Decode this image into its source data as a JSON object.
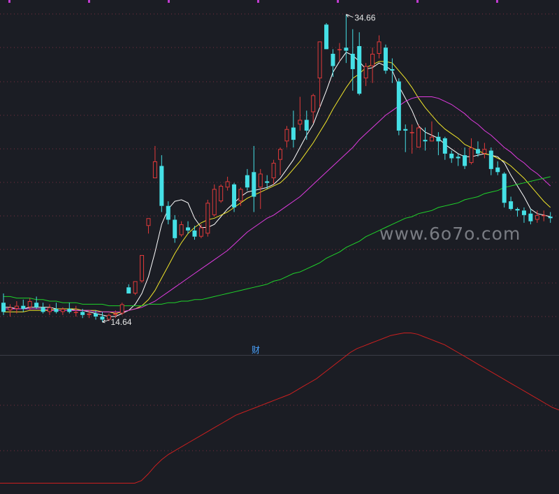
{
  "chart_data": [
    {
      "type": "candlestick",
      "annotations": {
        "high_label": "34.66",
        "low_label": "14.64"
      },
      "watermark": "www.6o7o.com",
      "ylim": [
        12.5,
        35.6
      ],
      "candles": [
        [
          15.9,
          16.5,
          15.1,
          15.3
        ],
        [
          15.4,
          15.8,
          15.0,
          15.6
        ],
        [
          15.5,
          16.0,
          15.2,
          15.7
        ],
        [
          15.7,
          16.1,
          15.3,
          15.5
        ],
        [
          15.6,
          16.2,
          15.4,
          16.0
        ],
        [
          15.9,
          16.3,
          15.5,
          15.6
        ],
        [
          15.6,
          15.9,
          15.2,
          15.3
        ],
        [
          15.3,
          15.8,
          15.1,
          15.6
        ],
        [
          15.5,
          15.9,
          15.2,
          15.3
        ],
        [
          15.3,
          15.6,
          15.1,
          15.5
        ],
        [
          15.5,
          15.9,
          15.2,
          15.3
        ],
        [
          15.3,
          15.7,
          15.0,
          15.3
        ],
        [
          15.3,
          15.5,
          14.9,
          15.1
        ],
        [
          15.1,
          15.4,
          14.9,
          15.2
        ],
        [
          15.2,
          15.4,
          14.8,
          15.0
        ],
        [
          15.0,
          15.3,
          14.64,
          14.8
        ],
        [
          14.8,
          15.2,
          14.7,
          15.1
        ],
        [
          15.1,
          15.4,
          14.9,
          15.2
        ],
        [
          15.2,
          15.9,
          15.1,
          15.8
        ],
        [
          16.9,
          17.1,
          16.5,
          16.5
        ],
        [
          16.5,
          17.3,
          16.4,
          17.3
        ],
        [
          17.3,
          19.0,
          17.2,
          19.0
        ],
        [
          20.9,
          21.4,
          20.4,
          21.4
        ],
        [
          24.0,
          26.1,
          24.0,
          25.1
        ],
        [
          24.8,
          25.5,
          21.8,
          22.2
        ],
        [
          22.2,
          22.5,
          21.0,
          21.3
        ],
        [
          21.3,
          21.6,
          19.8,
          20.1
        ],
        [
          20.3,
          21.2,
          20.2,
          21.0
        ],
        [
          20.8,
          21.2,
          20.4,
          20.6
        ],
        [
          20.6,
          20.9,
          20.0,
          20.2
        ],
        [
          20.2,
          21.0,
          20.1,
          20.8
        ],
        [
          20.4,
          22.6,
          20.2,
          22.4
        ],
        [
          21.6,
          23.6,
          21.5,
          23.3
        ],
        [
          22.5,
          23.6,
          22.4,
          23.5
        ],
        [
          23.4,
          24.1,
          23.2,
          23.8
        ],
        [
          23.6,
          23.7,
          21.8,
          22.1
        ],
        [
          22.5,
          23.4,
          22.2,
          23.3
        ],
        [
          24.2,
          24.6,
          23.2,
          23.4
        ],
        [
          24.4,
          26.1,
          21.8,
          22.8
        ],
        [
          23.4,
          24.6,
          22.0,
          24.3
        ],
        [
          23.8,
          24.2,
          23.3,
          23.7
        ],
        [
          24.0,
          25.2,
          23.6,
          25.0
        ],
        [
          25.2,
          26.0,
          24.2,
          25.9
        ],
        [
          26.4,
          27.4,
          26.0,
          27.2
        ],
        [
          27.3,
          28.4,
          26.0,
          26.5
        ],
        [
          27.5,
          29.3,
          27.1,
          27.8
        ],
        [
          27.8,
          28.4,
          26.5,
          27.1
        ],
        [
          28.3,
          29.5,
          27.6,
          29.4
        ],
        [
          30.5,
          32.9,
          28.6,
          32.9
        ],
        [
          34.0,
          34.1,
          32.5,
          32.4
        ],
        [
          32.1,
          32.4,
          30.6,
          31.3
        ],
        [
          32.4,
          32.8,
          31.6,
          32.4
        ],
        [
          32.5,
          34.66,
          31.5,
          32.3
        ],
        [
          32.1,
          33.7,
          29.7,
          31.1
        ],
        [
          32.6,
          33.5,
          29.4,
          29.5
        ],
        [
          30.5,
          31.5,
          30.0,
          31.3
        ],
        [
          31.3,
          32.5,
          30.2,
          32.1
        ],
        [
          32.1,
          33.3,
          31.8,
          32.9
        ],
        [
          32.5,
          32.7,
          30.8,
          31.0
        ],
        [
          31.1,
          31.8,
          30.2,
          31.0
        ],
        [
          30.3,
          30.5,
          26.8,
          27.1
        ],
        [
          27.2,
          27.5,
          25.7,
          27.1
        ],
        [
          27.0,
          27.5,
          25.6,
          27.0
        ],
        [
          26.0,
          27.5,
          26.0,
          27.3
        ],
        [
          26.5,
          27.3,
          25.8,
          26.4
        ],
        [
          26.4,
          27.7,
          26.4,
          26.7
        ],
        [
          26.7,
          27.0,
          25.5,
          26.4
        ],
        [
          26.6,
          26.7,
          25.2,
          25.6
        ],
        [
          25.6,
          25.8,
          25.0,
          25.3
        ],
        [
          25.4,
          25.6,
          24.8,
          25.3
        ],
        [
          25.5,
          26.0,
          24.6,
          24.8
        ],
        [
          25.0,
          26.6,
          24.9,
          26.0
        ],
        [
          25.9,
          26.4,
          25.4,
          25.6
        ],
        [
          25.6,
          26.3,
          25.3,
          25.9
        ],
        [
          25.8,
          26.0,
          24.2,
          24.6
        ],
        [
          24.7,
          25.1,
          24.2,
          24.4
        ],
        [
          24.3,
          24.4,
          22.1,
          22.4
        ],
        [
          22.5,
          22.8,
          21.9,
          22.0
        ],
        [
          22.0,
          22.1,
          21.5,
          21.9
        ],
        [
          21.9,
          22.1,
          21.1,
          21.6
        ],
        [
          21.7,
          22.0,
          21.0,
          21.2
        ],
        [
          21.3,
          21.9,
          21.1,
          21.6
        ],
        [
          21.6,
          21.9,
          21.2,
          21.6
        ],
        [
          21.5,
          21.8,
          21.1,
          21.4
        ]
      ],
      "ma_series": [
        {
          "color": "#ffffff",
          "values": [
            15.6,
            15.6,
            15.5,
            15.5,
            15.6,
            15.6,
            15.6,
            15.6,
            15.5,
            15.5,
            15.5,
            15.4,
            15.4,
            15.3,
            15.2,
            15.1,
            15.0,
            15.0,
            15.2,
            15.4,
            15.8,
            16.5,
            17.6,
            19.2,
            21.0,
            22.0,
            22.5,
            22.6,
            22.4,
            21.4,
            20.8,
            20.8,
            21.0,
            21.5,
            22.0,
            22.4,
            22.8,
            23.1,
            23.2,
            23.3,
            23.4,
            23.6,
            24.0,
            24.6,
            25.2,
            26.0,
            26.8,
            27.5,
            28.6,
            29.7,
            30.9,
            31.6,
            32.2,
            32.0,
            31.6,
            31.1,
            31.2,
            31.5,
            31.3,
            31.0,
            30.0,
            29.2,
            28.4,
            27.4,
            27.0,
            26.8,
            26.6,
            26.2,
            25.9,
            25.6,
            25.4,
            25.4,
            25.5,
            25.6,
            25.5,
            25.4,
            25.0,
            24.2,
            23.5,
            22.8,
            22.0,
            21.7,
            21.6,
            21.5
          ]
        },
        {
          "color": "#f0e52a",
          "values": [
            15.3,
            15.3,
            15.3,
            15.3,
            15.4,
            15.4,
            15.4,
            15.4,
            15.5,
            15.5,
            15.5,
            15.5,
            15.4,
            15.4,
            15.4,
            15.3,
            15.3,
            15.2,
            15.3,
            15.4,
            15.5,
            15.7,
            16.1,
            16.7,
            17.5,
            18.3,
            19.1,
            19.8,
            20.4,
            20.8,
            21.1,
            21.3,
            21.4,
            21.6,
            21.8,
            22.1,
            22.4,
            22.7,
            22.9,
            23.1,
            23.3,
            23.5,
            23.7,
            24.1,
            24.6,
            25.1,
            25.7,
            26.3,
            27.0,
            27.7,
            28.5,
            29.2,
            29.9,
            30.5,
            30.8,
            31.2,
            31.4,
            31.6,
            31.6,
            31.5,
            31.0,
            30.5,
            29.9,
            29.2,
            28.6,
            28.1,
            27.6,
            27.2,
            26.9,
            26.6,
            26.2,
            26.0,
            25.8,
            25.6,
            25.5,
            25.3,
            25.1,
            24.8,
            24.4,
            24.0,
            23.5,
            23.0,
            22.5,
            22.1
          ]
        },
        {
          "color": "#e03be0",
          "values": [
            15.5,
            15.5,
            15.5,
            15.5,
            15.5,
            15.5,
            15.5,
            15.4,
            15.4,
            15.4,
            15.4,
            15.4,
            15.4,
            15.4,
            15.3,
            15.3,
            15.3,
            15.3,
            15.3,
            15.4,
            15.5,
            15.6,
            15.8,
            16.0,
            16.3,
            16.6,
            16.9,
            17.2,
            17.5,
            17.8,
            18.1,
            18.4,
            18.7,
            19.0,
            19.3,
            19.7,
            20.1,
            20.5,
            20.8,
            21.1,
            21.4,
            21.6,
            21.9,
            22.2,
            22.5,
            22.8,
            23.2,
            23.6,
            24.0,
            24.4,
            24.8,
            25.2,
            25.6,
            26.0,
            26.5,
            26.9,
            27.3,
            27.7,
            28.1,
            28.4,
            28.7,
            29.0,
            29.2,
            29.3,
            29.3,
            29.3,
            29.2,
            29.0,
            28.8,
            28.5,
            28.2,
            27.8,
            27.5,
            27.1,
            26.8,
            26.4,
            26.0,
            25.7,
            25.3,
            25.0,
            24.6,
            24.3,
            23.9,
            23.5
          ]
        },
        {
          "color": "#1fd42a",
          "values": [
            16.3,
            16.3,
            16.2,
            16.2,
            16.2,
            16.1,
            16.1,
            16.0,
            16.0,
            15.9,
            15.9,
            15.9,
            15.8,
            15.8,
            15.8,
            15.8,
            15.7,
            15.7,
            15.7,
            15.7,
            15.7,
            15.7,
            15.8,
            15.8,
            15.8,
            15.9,
            15.9,
            16.0,
            16.0,
            16.1,
            16.1,
            16.2,
            16.3,
            16.4,
            16.5,
            16.6,
            16.7,
            16.8,
            16.9,
            17.0,
            17.1,
            17.3,
            17.4,
            17.6,
            17.8,
            17.9,
            18.1,
            18.3,
            18.5,
            18.8,
            19.0,
            19.2,
            19.5,
            19.7,
            19.9,
            20.2,
            20.4,
            20.6,
            20.8,
            21.0,
            21.2,
            21.4,
            21.5,
            21.7,
            21.8,
            21.9,
            22.1,
            22.2,
            22.3,
            22.4,
            22.6,
            22.7,
            22.8,
            23.0,
            23.1,
            23.2,
            23.4,
            23.5,
            23.6,
            23.7,
            23.8,
            23.9,
            24.0,
            24.1
          ]
        }
      ]
    },
    {
      "type": "line",
      "title": "财",
      "ylim": [
        0,
        100
      ],
      "series": [
        {
          "color": "#cc1f1f",
          "values": [
            4,
            4,
            4,
            4,
            4,
            4,
            4,
            4,
            4,
            4,
            4,
            4,
            4,
            4,
            4,
            4,
            4,
            4,
            4,
            4,
            4,
            6,
            11,
            17,
            22,
            26,
            29,
            32,
            35,
            38,
            41,
            44,
            47,
            50,
            53,
            56,
            58,
            60,
            62,
            64,
            66,
            68,
            70,
            72,
            75,
            78,
            81,
            84,
            88,
            92,
            96,
            100,
            104,
            107,
            109,
            111,
            113,
            115,
            117,
            118,
            119,
            119,
            118,
            116,
            114,
            112,
            110,
            107,
            104,
            101,
            98,
            95,
            92,
            89,
            86,
            83,
            80,
            77,
            74,
            71,
            68,
            65,
            62,
            60
          ]
        }
      ]
    }
  ]
}
